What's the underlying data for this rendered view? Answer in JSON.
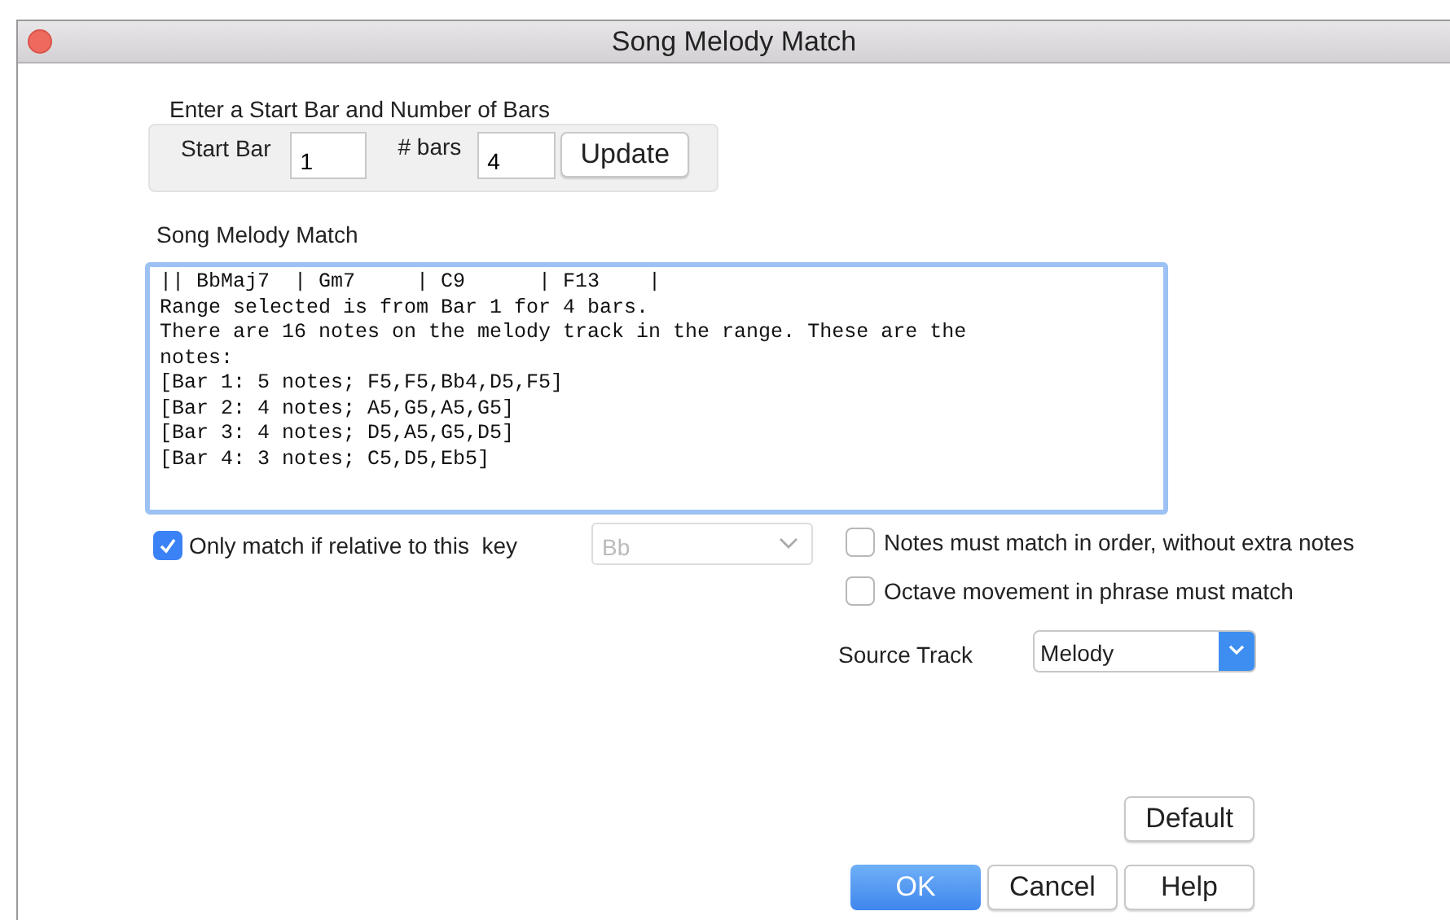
{
  "window": {
    "title": "Song Melody Match"
  },
  "range_group": {
    "title": "Enter a Start Bar and Number of Bars",
    "start_bar": {
      "label": "Start Bar",
      "value": "1"
    },
    "num_bars": {
      "label": "# bars",
      "value": "4"
    },
    "update_button": "Update"
  },
  "result": {
    "label": "Song Melody Match",
    "lines": [
      "|| BbMaj7  | Gm7     | C9      | F13    |",
      "Range selected is from Bar 1 for 4 bars.",
      "There are 16 notes on the melody track in the range. These are the",
      "notes:",
      "[Bar 1: 5 notes; F5,F5,Bb4,D5,F5]",
      "[Bar 2: 4 notes; A5,G5,A5,G5]",
      "[Bar 3: 4 notes; D5,A5,G5,D5]",
      "[Bar 4: 3 notes; C5,D5,Eb5]"
    ]
  },
  "key_option": {
    "label": "Only match if relative to this  key",
    "checked": true,
    "key_select": {
      "value": "Bb",
      "disabled": true
    }
  },
  "options": [
    {
      "label": "Notes must match in order, without extra notes",
      "checked": false
    },
    {
      "label": "Octave movement in phrase must match",
      "checked": false
    }
  ],
  "source_track": {
    "label": "Source Track",
    "value": "Melody"
  },
  "buttons": {
    "default": "Default",
    "ok": "OK",
    "cancel": "Cancel",
    "help": "Help"
  }
}
